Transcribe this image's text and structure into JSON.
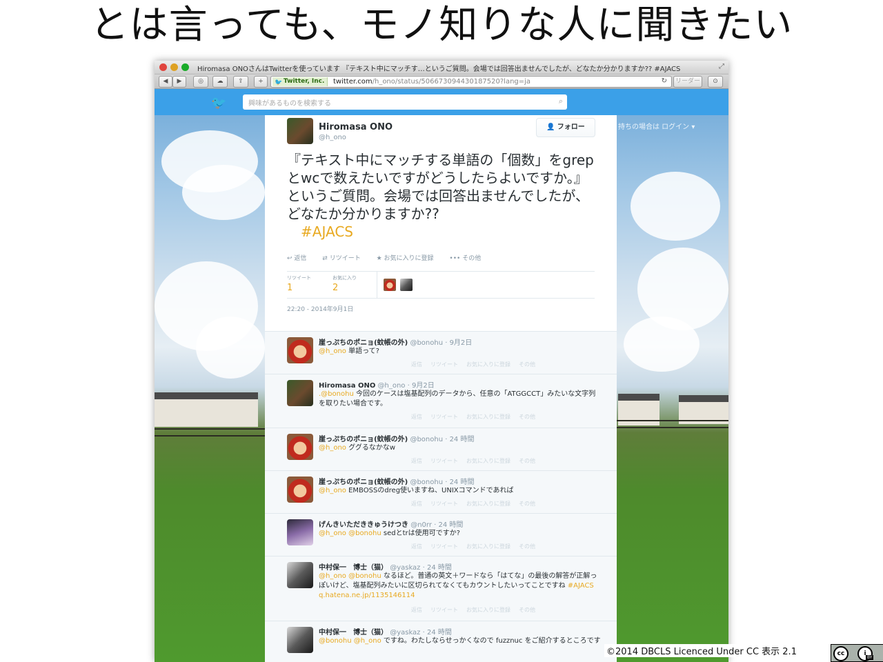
{
  "slide": {
    "title": "とは言っても、モノ知りな人に聞きたい",
    "footer": "©2014 DBCLS Licenced Under CC 表示 2.1"
  },
  "browser": {
    "window_title": "Hiromasa ONOさんはTwitterを使っています 『テキスト中にマッチす…というご質問。会場では回答出ませんでしたが、どなたか分かりますか?? #AJACS",
    "site_badge": "Twitter, Inc.",
    "url_host": "twitter.com",
    "url_path": "/h_ono/status/506673094430187520?lang=ja",
    "reader_label": "リーダー"
  },
  "twitter": {
    "search_placeholder": "興味があるものを検索する",
    "login_text": "持ちの場合は ログイン ▾"
  },
  "tweet": {
    "author": "Hiromasa ONO",
    "handle": "@h_ono",
    "follow_label": "フォロー",
    "text": "『テキスト中にマッチする単語の「個数」をgrepとwcで数えたいですがどうしたらよいですか。』というご質問。会場では回答出ませんでしたが、どなたか分かりますか??",
    "hashtag": "#AJACS",
    "actions": {
      "reply": "返信",
      "retweet": "リツイート",
      "favorite": "お気に入りに登録",
      "more": "その他"
    },
    "stats": {
      "retweets_label": "リツイート",
      "retweets": "1",
      "favorites_label": "お気に入り",
      "favorites": "2"
    },
    "timestamp": "22:20 - 2014年9月1日"
  },
  "replies": [
    {
      "name": "崖っぷちのポニョ(蚊帳の外)",
      "meta": "@bonohu · 9月2日",
      "mention": "@h_ono",
      "text": " 単語って?"
    },
    {
      "name": "Hiromasa ONO",
      "meta": "@h_ono · 9月2日",
      "mention": ".@bonohu",
      "text": " 今回のケースは塩基配列のデータから、任意の「ATGGCCT」みたいな文字列を取りたい場合です。"
    },
    {
      "name": "崖っぷちのポニョ(蚊帳の外)",
      "meta": "@bonohu · 24 時間",
      "mention": "@h_ono",
      "text": " ググるなかなw"
    },
    {
      "name": "崖っぷちのポニョ(蚊帳の外)",
      "meta": "@bonohu · 24 時間",
      "mention": "@h_ono",
      "text": " EMBOSSのdreg使いますね、UNIXコマンドであれば"
    },
    {
      "name": "げんきいただききゅうけつき",
      "meta": "@n0rr · 24 時間",
      "mention": "@h_ono @bonohu",
      "text": " sedとtrは使用可ですか?"
    },
    {
      "name": "中村保一　博士（猫）",
      "meta": "@yaskaz · 24 時間",
      "mention": "@h_ono @bonohu",
      "text": " なるほど。普通の英文＋ワードなら「はてな」の最後の解答が正解っぽいけど、塩基配列みたいに区切られてなくてもカウントしたいってことですね ",
      "extra": "#AJACS q.hatena.ne.jp/1135146114"
    },
    {
      "name": "中村保一　博士（猫）",
      "meta": "@yaskaz · 24 時間",
      "mention": "@bonohu @h_ono",
      "text": " ですね。わたしならせっかくなので fuzznuc をご紹介するところです"
    }
  ],
  "reply_actions": {
    "reply": "返信",
    "retweet": "リツイート",
    "favorite": "お気に入りに登録",
    "more": "その他"
  },
  "license_badge": {
    "cc": "cc",
    "by_icon": "i",
    "by": "BY"
  }
}
